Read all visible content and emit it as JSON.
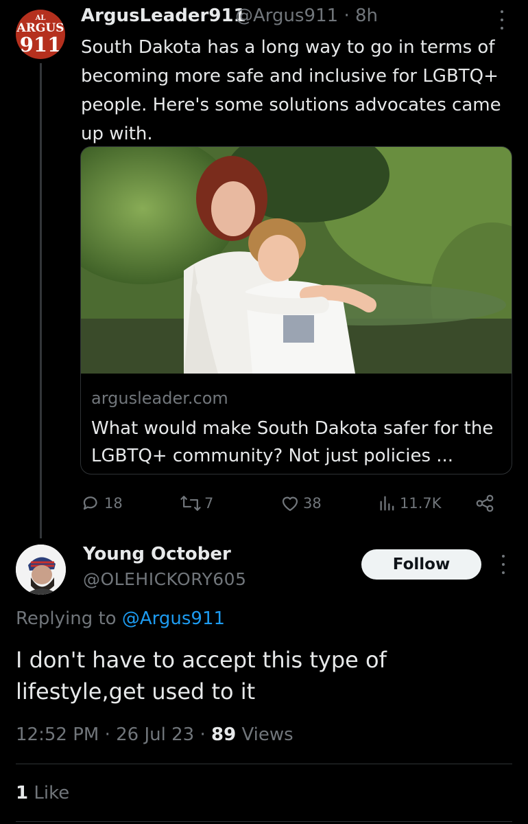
{
  "parent_tweet": {
    "avatar": {
      "line1": "AL",
      "line2": "ARGUS",
      "line3": "911"
    },
    "display_name": "ArgusLeader911",
    "handle": "@Argus911",
    "separator": "·",
    "time": "8h",
    "text": "South Dakota has a long way to go in terms of becoming more safe and inclusive for LGBTQ+ people. Here's some solutions advocates came up with.",
    "card": {
      "domain": "argusleader.com",
      "title": "What would make South Dakota safer for the LGBTQ+ community? Not just policies ..."
    },
    "actions": {
      "replies": "18",
      "reposts": "7",
      "likes": "38",
      "views": "11.7K"
    }
  },
  "reply": {
    "display_name": "Young October",
    "handle": "@OLEHICKORY605",
    "follow_label": "Follow",
    "replying_prefix": "Replying to",
    "replying_mention": "@Argus911",
    "text": "I don't have to accept this type of lifestyle,get used to it",
    "time": "12:52 PM",
    "date": "26 Jul 23",
    "views_count": "89",
    "views_label": "Views",
    "likes_count": "1",
    "likes_label": "Like"
  },
  "colors": {
    "background": "#000000",
    "text": "#e7e9ea",
    "muted": "#71767b",
    "link": "#1d9bf0",
    "argus_brand": "#b5301e"
  }
}
